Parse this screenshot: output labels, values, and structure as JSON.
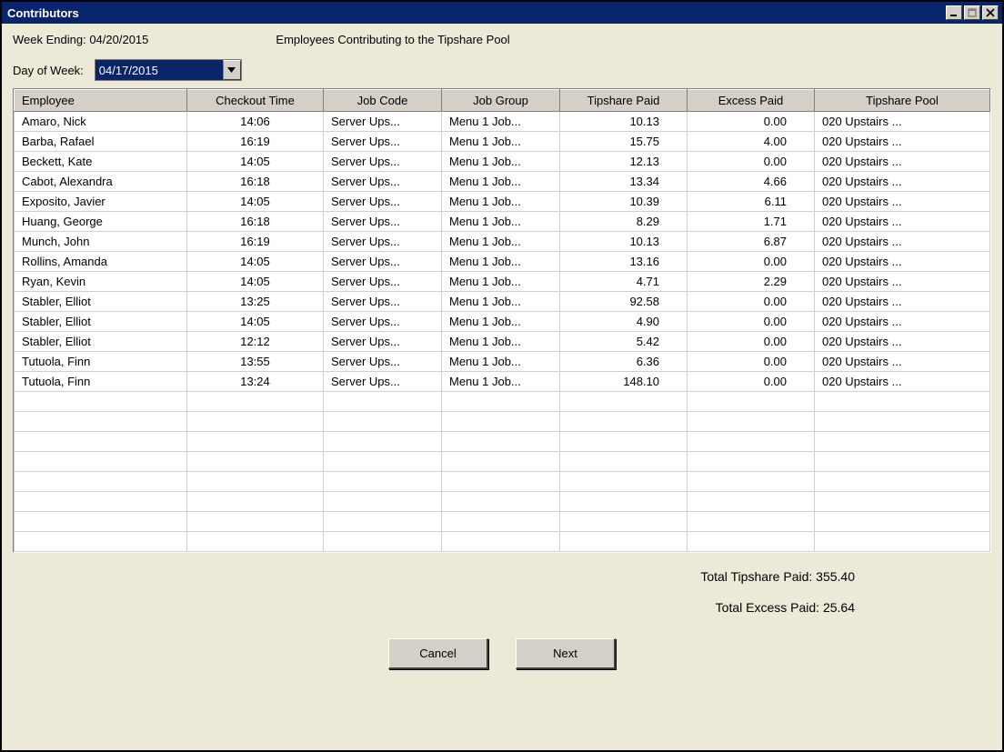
{
  "window": {
    "title": "Contributors"
  },
  "header": {
    "week_ending_label": "Week Ending:",
    "week_ending_value": "04/20/2015",
    "page_title": "Employees Contributing to the Tipshare Pool",
    "day_of_week_label": "Day of Week:",
    "day_of_week_value": "04/17/2015"
  },
  "columns": {
    "employee": "Employee",
    "checkout_time": "Checkout Time",
    "job_code": "Job Code",
    "job_group": "Job Group",
    "tipshare_paid": "Tipshare Paid",
    "excess_paid": "Excess Paid",
    "tipshare_pool": "Tipshare Pool"
  },
  "rows": [
    {
      "employee": "Amaro, Nick",
      "checkout_time": "14:06",
      "job_code": "Server Ups...",
      "job_group": "Menu 1 Job...",
      "tipshare_paid": "10.13",
      "excess_paid": "0.00",
      "tipshare_pool": "020 Upstairs ..."
    },
    {
      "employee": "Barba, Rafael",
      "checkout_time": "16:19",
      "job_code": "Server Ups...",
      "job_group": "Menu 1 Job...",
      "tipshare_paid": "15.75",
      "excess_paid": "4.00",
      "tipshare_pool": "020 Upstairs ..."
    },
    {
      "employee": "Beckett, Kate",
      "checkout_time": "14:05",
      "job_code": "Server Ups...",
      "job_group": "Menu 1 Job...",
      "tipshare_paid": "12.13",
      "excess_paid": "0.00",
      "tipshare_pool": "020 Upstairs ..."
    },
    {
      "employee": "Cabot, Alexandra",
      "checkout_time": "16:18",
      "job_code": "Server Ups...",
      "job_group": "Menu 1 Job...",
      "tipshare_paid": "13.34",
      "excess_paid": "4.66",
      "tipshare_pool": "020 Upstairs ..."
    },
    {
      "employee": "Exposito, Javier",
      "checkout_time": "14:05",
      "job_code": "Server Ups...",
      "job_group": "Menu 1 Job...",
      "tipshare_paid": "10.39",
      "excess_paid": "6.11",
      "tipshare_pool": "020 Upstairs ..."
    },
    {
      "employee": "Huang, George",
      "checkout_time": "16:18",
      "job_code": "Server Ups...",
      "job_group": "Menu 1 Job...",
      "tipshare_paid": "8.29",
      "excess_paid": "1.71",
      "tipshare_pool": "020 Upstairs ..."
    },
    {
      "employee": "Munch, John",
      "checkout_time": "16:19",
      "job_code": "Server Ups...",
      "job_group": "Menu 1 Job...",
      "tipshare_paid": "10.13",
      "excess_paid": "6.87",
      "tipshare_pool": "020 Upstairs ..."
    },
    {
      "employee": "Rollins, Amanda",
      "checkout_time": "14:05",
      "job_code": "Server Ups...",
      "job_group": "Menu 1 Job...",
      "tipshare_paid": "13.16",
      "excess_paid": "0.00",
      "tipshare_pool": "020 Upstairs ..."
    },
    {
      "employee": "Ryan, Kevin",
      "checkout_time": "14:05",
      "job_code": "Server Ups...",
      "job_group": "Menu 1 Job...",
      "tipshare_paid": "4.71",
      "excess_paid": "2.29",
      "tipshare_pool": "020 Upstairs ..."
    },
    {
      "employee": "Stabler, Elliot",
      "checkout_time": "13:25",
      "job_code": "Server Ups...",
      "job_group": "Menu 1 Job...",
      "tipshare_paid": "92.58",
      "excess_paid": "0.00",
      "tipshare_pool": "020 Upstairs ..."
    },
    {
      "employee": "Stabler, Elliot",
      "checkout_time": "14:05",
      "job_code": "Server Ups...",
      "job_group": "Menu 1 Job...",
      "tipshare_paid": "4.90",
      "excess_paid": "0.00",
      "tipshare_pool": "020 Upstairs ..."
    },
    {
      "employee": "Stabler, Elliot",
      "checkout_time": "12:12",
      "job_code": "Server Ups...",
      "job_group": "Menu 1 Job...",
      "tipshare_paid": "5.42",
      "excess_paid": "0.00",
      "tipshare_pool": "020 Upstairs ..."
    },
    {
      "employee": "Tutuola, Finn",
      "checkout_time": "13:55",
      "job_code": "Server Ups...",
      "job_group": "Menu 1 Job...",
      "tipshare_paid": "6.36",
      "excess_paid": "0.00",
      "tipshare_pool": "020 Upstairs ..."
    },
    {
      "employee": "Tutuola, Finn",
      "checkout_time": "13:24",
      "job_code": "Server Ups...",
      "job_group": "Menu 1 Job...",
      "tipshare_paid": "148.10",
      "excess_paid": "0.00",
      "tipshare_pool": "020 Upstairs ..."
    }
  ],
  "blank_row_count": 8,
  "totals": {
    "tipshare_label": "Total Tipshare Paid:",
    "tipshare_value": "355.40",
    "excess_label": "Total Excess Paid:",
    "excess_value": "25.64"
  },
  "buttons": {
    "cancel": "Cancel",
    "next": "Next"
  }
}
